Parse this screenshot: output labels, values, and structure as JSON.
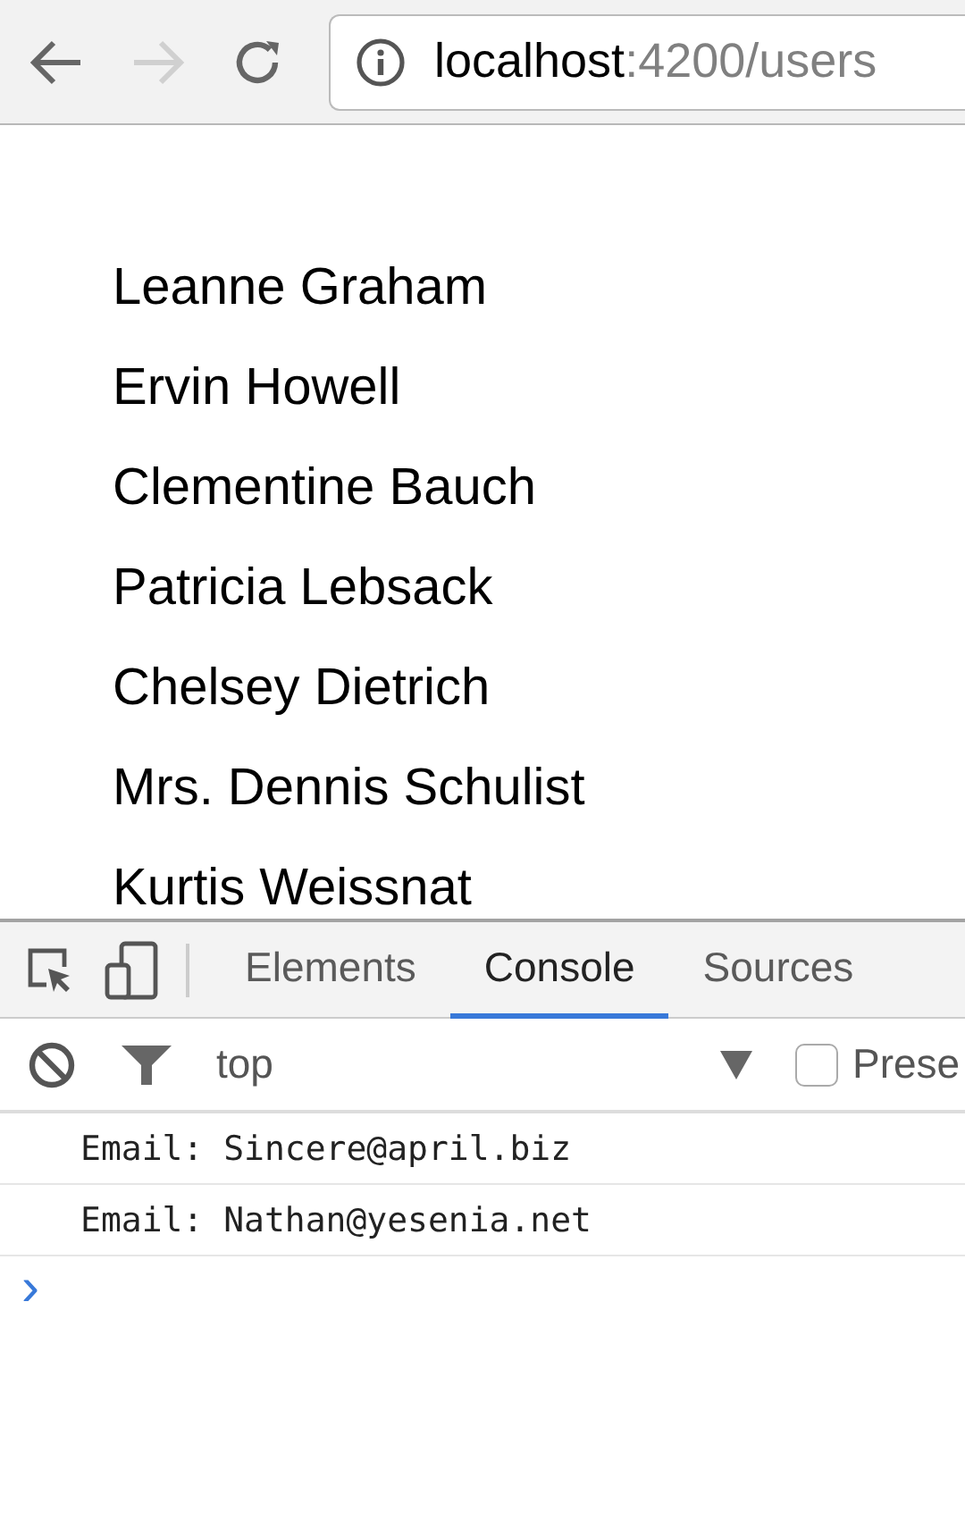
{
  "browser": {
    "back": {
      "disabled": false
    },
    "forward": {
      "disabled": true
    },
    "address": {
      "host": "localhost",
      "path": ":4200/users"
    }
  },
  "users": [
    "Leanne Graham",
    "Ervin Howell",
    "Clementine Bauch",
    "Patricia Lebsack",
    "Chelsey Dietrich",
    "Mrs. Dennis Schulist",
    "Kurtis Weissnat"
  ],
  "devtools": {
    "tabs": [
      {
        "label": "Elements",
        "selected": false
      },
      {
        "label": "Console",
        "selected": true
      },
      {
        "label": "Sources",
        "selected": false
      }
    ],
    "context": "top",
    "preserve_log": {
      "label": "Prese",
      "checked": false
    },
    "messages": [
      "Email: Sincere@april.biz",
      "Email: Nathan@yesenia.net"
    ],
    "prompt": "›"
  }
}
